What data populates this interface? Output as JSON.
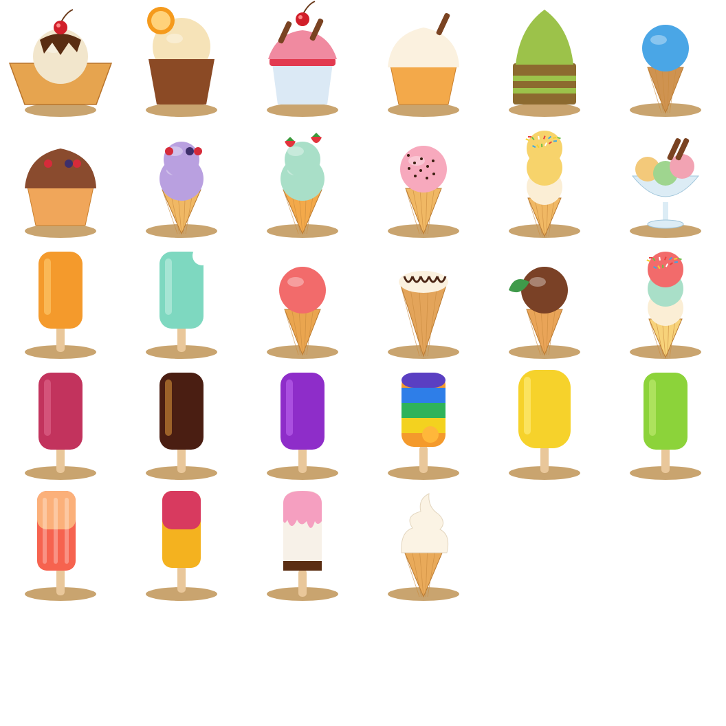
{
  "colors": {
    "shadow": "#c9a46f",
    "waffle": "#e6a44f",
    "waffle_dark": "#b8742c",
    "cone": "#f0b864",
    "stick": "#e9c79a"
  },
  "items": [
    {
      "name": "waffle-bowl-sundae",
      "kind": "waffle-bowl",
      "scoop": "#f2e6cc",
      "accent": "#5a2d12",
      "topping": "cherry"
    },
    {
      "name": "tulip-cup-vanilla",
      "kind": "tulip",
      "scoop": "#f6e3b8",
      "cup": "#8b4a25",
      "topping": "orange-slice"
    },
    {
      "name": "strawberry-cup-sundae",
      "kind": "cup",
      "scoop": "#f08aa0",
      "cup": "#dbe9f5",
      "topping": "cherry"
    },
    {
      "name": "vanilla-waffle-cup",
      "kind": "waffle-cup",
      "scoop": "#fbf1df",
      "cup": "#f3a94a",
      "topping": "wafer"
    },
    {
      "name": "matcha-tub",
      "kind": "tub",
      "scoop": "#9cc24a",
      "cup": "#8c6a2f",
      "topping": "none"
    },
    {
      "name": "blue-cone",
      "kind": "cone",
      "scoop": "#4aa6e6",
      "cone": "#cf9350",
      "topping": "none"
    },
    {
      "name": "chocolate-berry-cup",
      "kind": "waffle-cup",
      "scoop": "#8a4b2e",
      "cup": "#f0a65a",
      "topping": "berries"
    },
    {
      "name": "purple-cone",
      "kind": "cone-2",
      "scoop": "#b9a0e0",
      "cone": "#f0b864",
      "topping": "berries"
    },
    {
      "name": "mint-strawberry-cone",
      "kind": "cone-2",
      "scoop": "#a9dfc8",
      "cone": "#f3a94a",
      "topping": "strawberry"
    },
    {
      "name": "pink-chip-cone",
      "kind": "cone",
      "scoop": "#f7a9bd",
      "cone": "#f0b864",
      "topping": "chips"
    },
    {
      "name": "triple-yellow-cone",
      "kind": "cone-3",
      "scoop": "#f7d36b",
      "cone": "#f0b864",
      "topping": "sprinkles"
    },
    {
      "name": "glass-sundae",
      "kind": "glass",
      "scoop": "#f3c97a",
      "cup": "#dcecf5",
      "topping": "wafer"
    },
    {
      "name": "orange-popsicle",
      "kind": "popsicle",
      "body": "#f49a2c",
      "accent": "#ffd27a"
    },
    {
      "name": "mint-bitten-popsicle",
      "kind": "popsicle-bite",
      "body": "#7ed8c0",
      "accent": "#c6f1e4"
    },
    {
      "name": "strawberry-waffle-cone",
      "kind": "cone",
      "scoop": "#f26b6b",
      "cone": "#eaa54f",
      "topping": "none"
    },
    {
      "name": "chocolate-swirl-cone",
      "kind": "cone-long",
      "scoop": "#fbf1df",
      "cone": "#e3a45a",
      "topping": "choc-swirl"
    },
    {
      "name": "chocolate-mint-cone",
      "kind": "cone",
      "scoop": "#7a4126",
      "cone": "#e9a458",
      "topping": "mint-leaf"
    },
    {
      "name": "rainbow-sprinkle-cone",
      "kind": "cone-3",
      "scoop": "#f26b6b",
      "cone": "#f7d27a",
      "topping": "sprinkles"
    },
    {
      "name": "berry-popsicle",
      "kind": "popsicle",
      "body": "#c2335d",
      "accent": "#e36d91"
    },
    {
      "name": "choco-nut-popsicle",
      "kind": "popsicle",
      "body": "#4a1e12",
      "accent": "#e09a3c"
    },
    {
      "name": "grape-popsicle",
      "kind": "popsicle",
      "body": "#8e2dc9",
      "accent": "#c16cf2"
    },
    {
      "name": "rainbow-popsicle",
      "kind": "popsicle-rainbow",
      "body": "#f49a2c",
      "accent": "#5a3fc2"
    },
    {
      "name": "lemon-popsicle",
      "kind": "popsicle-big",
      "body": "#f6d22b",
      "accent": "#fff08a"
    },
    {
      "name": "kiwi-popsicle",
      "kind": "popsicle",
      "body": "#8cd33a",
      "accent": "#c9ef7a"
    },
    {
      "name": "peach-stripe-popsicle",
      "kind": "popsicle-stripe",
      "body": "#f6634f",
      "accent": "#fbb07a"
    },
    {
      "name": "berry-mango-popsicle",
      "kind": "popsicle-two",
      "body": "#d83a5f",
      "accent": "#f4b21f"
    },
    {
      "name": "pink-dipped-popsicle",
      "kind": "popsicle-dip",
      "body": "#f7f1e8",
      "accent": "#f59fc0"
    },
    {
      "name": "soft-serve-cone",
      "kind": "soft-serve",
      "scoop": "#fbf3e4",
      "cone": "#e9aa5a",
      "topping": "none"
    }
  ]
}
